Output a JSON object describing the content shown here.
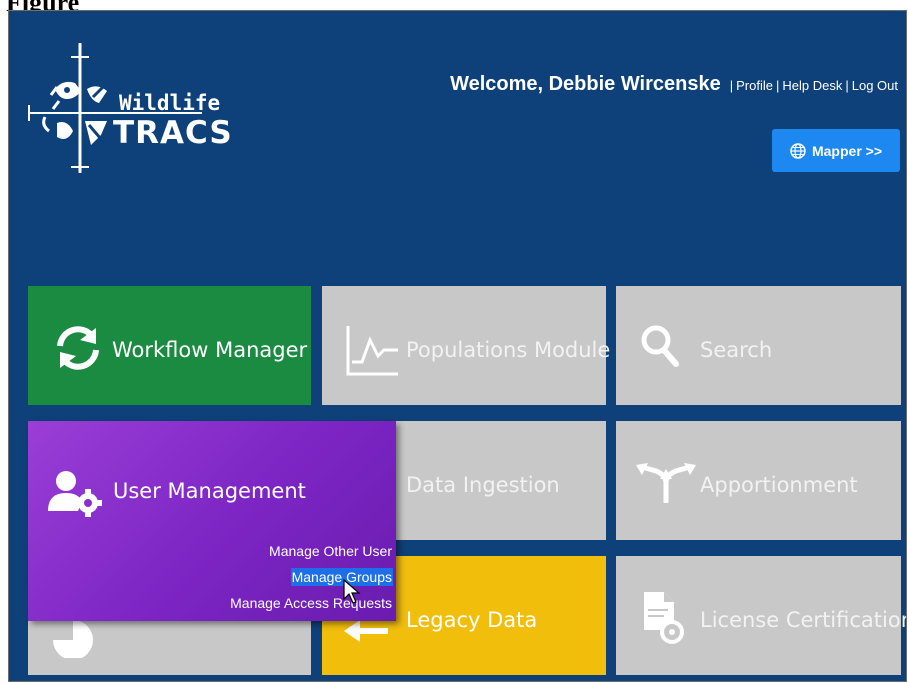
{
  "figure_label": "Figure",
  "header": {
    "logo_line1": "Wildlife",
    "logo_line2": "TRACS",
    "welcome": "Welcome, Debbie Wircenske",
    "links": [
      "Profile",
      "Help Desk",
      "Log Out"
    ],
    "separator": "|",
    "mapper_button": "Mapper >>"
  },
  "tiles": {
    "workflow": "Workflow Manager",
    "populations": "Populations Module",
    "search": "Search",
    "data_ingestion": "Data Ingestion",
    "apportionment": "Apportionment",
    "legacy_data": "Legacy Data",
    "license_certification": "License Certification"
  },
  "user_management": {
    "title": "User Management",
    "menu": [
      {
        "label": "Manage Other User",
        "selected": false
      },
      {
        "label": "Manage Groups",
        "selected": true
      },
      {
        "label": "Manage Access Requests",
        "selected": false
      }
    ]
  },
  "colors": {
    "background": "#0e4179",
    "workflow": "#1b8b42",
    "legacy": "#f1be0c",
    "user_management": "#8a2fcd",
    "tile_gray": "#c8c8c8",
    "mapper": "#1e88f1",
    "selection": "#1d6fe8"
  },
  "icons": {
    "workflow": "refresh-cycle-icon",
    "populations": "line-chart-icon",
    "search": "magnifier-icon",
    "apportionment": "arrows-split-icon",
    "legacy": "arrow-left-icon",
    "license": "document-gear-icon",
    "user_management": "user-gear-icon",
    "mapper": "globe-icon"
  }
}
